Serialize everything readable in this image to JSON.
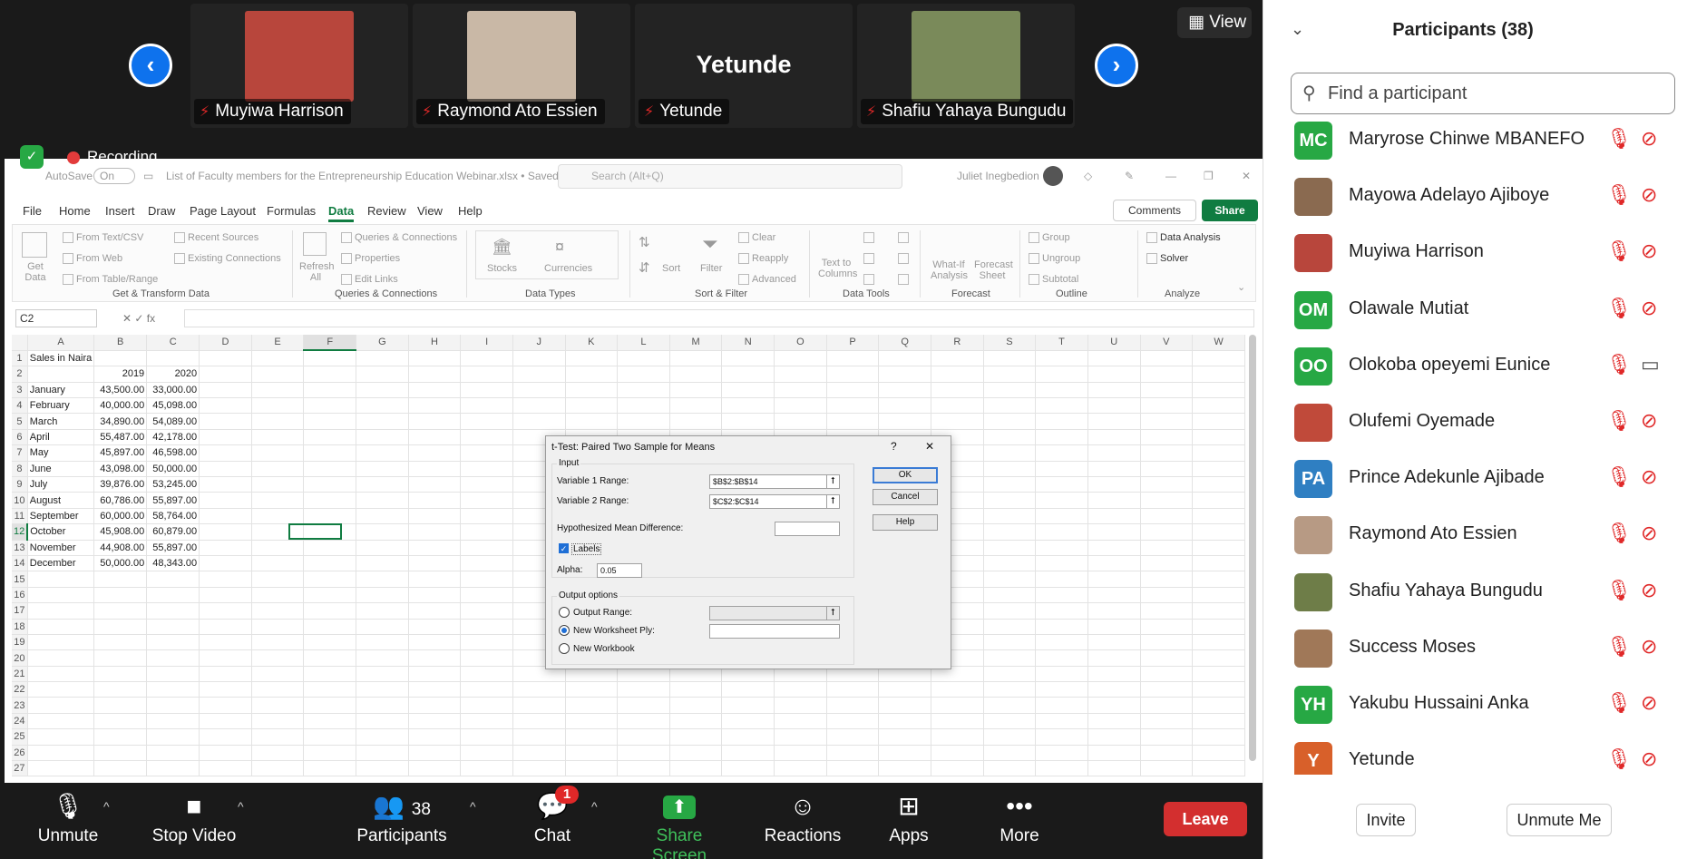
{
  "video": {
    "tiles": [
      {
        "name": "Muyiwa Harrison",
        "has_photo": true,
        "photo_color": "#b8463c"
      },
      {
        "name": "Raymond Ato Essien",
        "has_photo": true,
        "photo_color": "#c9b8a6"
      },
      {
        "name": "Yetunde",
        "has_photo": false
      },
      {
        "name": "Shafiu Yahaya Bungudu",
        "has_photo": true,
        "photo_color": "#7a8a5a"
      }
    ],
    "view_label": "View",
    "recording_label": "Recording"
  },
  "excel": {
    "autosave_label": "AutoSave",
    "autosave_state": "On",
    "file_title": "List of Faculty members for the Entrepreneurship Education Webinar.xlsx • Saved",
    "search_placeholder": "Search (Alt+Q)",
    "user_name": "Juliet Inegbedion",
    "menu": [
      "File",
      "Home",
      "Insert",
      "Draw",
      "Page Layout",
      "Formulas",
      "Data",
      "Review",
      "View",
      "Help"
    ],
    "active_menu": "Data",
    "comments_label": "Comments",
    "share_label": "Share",
    "ribbon": {
      "get_data": "Get Data",
      "from_text_csv": "From Text/CSV",
      "from_web": "From Web",
      "from_table": "From Table/Range",
      "recent_sources": "Recent Sources",
      "existing_connections": "Existing Connections",
      "group_get_transform": "Get & Transform Data",
      "refresh_all": "Refresh All",
      "queries_connections": "Queries & Connections",
      "properties": "Properties",
      "edit_links": "Edit Links",
      "group_queries": "Queries & Connections",
      "stocks": "Stocks",
      "currencies": "Currencies",
      "group_data_types": "Data Types",
      "sort": "Sort",
      "filter": "Filter",
      "clear": "Clear",
      "reapply": "Reapply",
      "advanced": "Advanced",
      "group_sort_filter": "Sort & Filter",
      "text_to_columns": "Text to Columns",
      "group_data_tools": "Data Tools",
      "what_if": "What-If Analysis",
      "forecast_sheet": "Forecast Sheet",
      "group_forecast": "Forecast",
      "group_btn": "Group",
      "ungroup_btn": "Ungroup",
      "subtotal": "Subtotal",
      "group_outline": "Outline",
      "data_analysis": "Data Analysis",
      "solver": "Solver",
      "group_analyze": "Analyze"
    },
    "name_box": "C2",
    "fx": "fx",
    "columns": [
      "A",
      "B",
      "C",
      "D",
      "E",
      "F",
      "G",
      "H",
      "I",
      "J",
      "K",
      "L",
      "M",
      "N",
      "O",
      "P",
      "Q",
      "R",
      "S",
      "T",
      "U",
      "V",
      "W"
    ],
    "selected_column": "F",
    "selected_row": "12",
    "rows": [
      [
        "Sales in Naira",
        "",
        ""
      ],
      [
        "",
        "2019",
        "2020"
      ],
      [
        "January",
        "43,500.00",
        "33,000.00"
      ],
      [
        "February",
        "40,000.00",
        "45,098.00"
      ],
      [
        "March",
        "34,890.00",
        "54,089.00"
      ],
      [
        "April",
        "55,487.00",
        "42,178.00"
      ],
      [
        "May",
        "45,897.00",
        "46,598.00"
      ],
      [
        "June",
        "43,098.00",
        "50,000.00"
      ],
      [
        "July",
        "39,876.00",
        "53,245.00"
      ],
      [
        "August",
        "60,786.00",
        "55,897.00"
      ],
      [
        "September",
        "60,000.00",
        "58,764.00"
      ],
      [
        "October",
        "45,908.00",
        "60,879.00"
      ],
      [
        "November",
        "44,908.00",
        "55,897.00"
      ],
      [
        "December",
        "50,000.00",
        "48,343.00"
      ]
    ],
    "row_count": 27
  },
  "dialog": {
    "title": "t-Test: Paired Two Sample for Means",
    "help_glyph": "?",
    "close_glyph": "✕",
    "input_label": "Input",
    "var1_label": "Variable 1 Range:",
    "var1_value": "$B$2:$B$14",
    "var2_label": "Variable 2 Range:",
    "var2_value": "$C$2:$C$14",
    "hyp_label": "Hypothesized Mean Difference:",
    "hyp_value": "",
    "labels_label": "Labels",
    "labels_checked": true,
    "alpha_label": "Alpha:",
    "alpha_value": "0.05",
    "output_options_label": "Output options",
    "output_range_label": "Output Range:",
    "new_worksheet_label": "New Worksheet Ply:",
    "new_workbook_label": "New Workbook",
    "ok": "OK",
    "cancel": "Cancel",
    "help": "Help"
  },
  "toolbar": {
    "unmute": "Unmute",
    "stop_video": "Stop Video",
    "participants": "Participants",
    "participants_count": "38",
    "chat": "Chat",
    "chat_badge": "1",
    "share_screen": "Share Screen",
    "reactions": "Reactions",
    "apps": "Apps",
    "more": "More",
    "leave": "Leave"
  },
  "participants_panel": {
    "title": "Participants (38)",
    "search_placeholder": "Find a participant",
    "items": [
      {
        "initials": "MC",
        "name": "Maryrose Chinwe MBANEFO",
        "avatar_color": "#27a844",
        "photo": false,
        "video_on": false
      },
      {
        "initials": "",
        "name": "Mayowa Adelayo Ajiboye",
        "avatar_color": "#8a6a50",
        "photo": true,
        "video_on": false
      },
      {
        "initials": "",
        "name": "Muyiwa Harrison",
        "avatar_color": "#b8463c",
        "photo": true,
        "video_on": false
      },
      {
        "initials": "OM",
        "name": "Olawale Mutiat",
        "avatar_color": "#27a844",
        "photo": false,
        "video_on": false
      },
      {
        "initials": "OO",
        "name": "Olokoba opeyemi Eunice",
        "avatar_color": "#27a844",
        "photo": false,
        "video_on": true
      },
      {
        "initials": "",
        "name": "Olufemi Oyemade",
        "avatar_color": "#c04a3a",
        "photo": true,
        "video_on": false
      },
      {
        "initials": "PA",
        "name": "Prince Adekunle Ajibade",
        "avatar_color": "#2f7fc2",
        "photo": false,
        "video_on": false
      },
      {
        "initials": "",
        "name": "Raymond Ato Essien",
        "avatar_color": "#b79a84",
        "photo": true,
        "video_on": false
      },
      {
        "initials": "",
        "name": "Shafiu Yahaya Bungudu",
        "avatar_color": "#6e7d48",
        "photo": true,
        "video_on": false
      },
      {
        "initials": "",
        "name": "Success Moses",
        "avatar_color": "#a07858",
        "photo": true,
        "video_on": false
      },
      {
        "initials": "YH",
        "name": "Yakubu Hussaini Anka",
        "avatar_color": "#27a844",
        "photo": false,
        "video_on": false
      },
      {
        "initials": "Y",
        "name": "Yetunde",
        "avatar_color": "#d8602a",
        "photo": false,
        "video_on": false
      }
    ],
    "invite": "Invite",
    "unmute_me": "Unmute Me"
  }
}
